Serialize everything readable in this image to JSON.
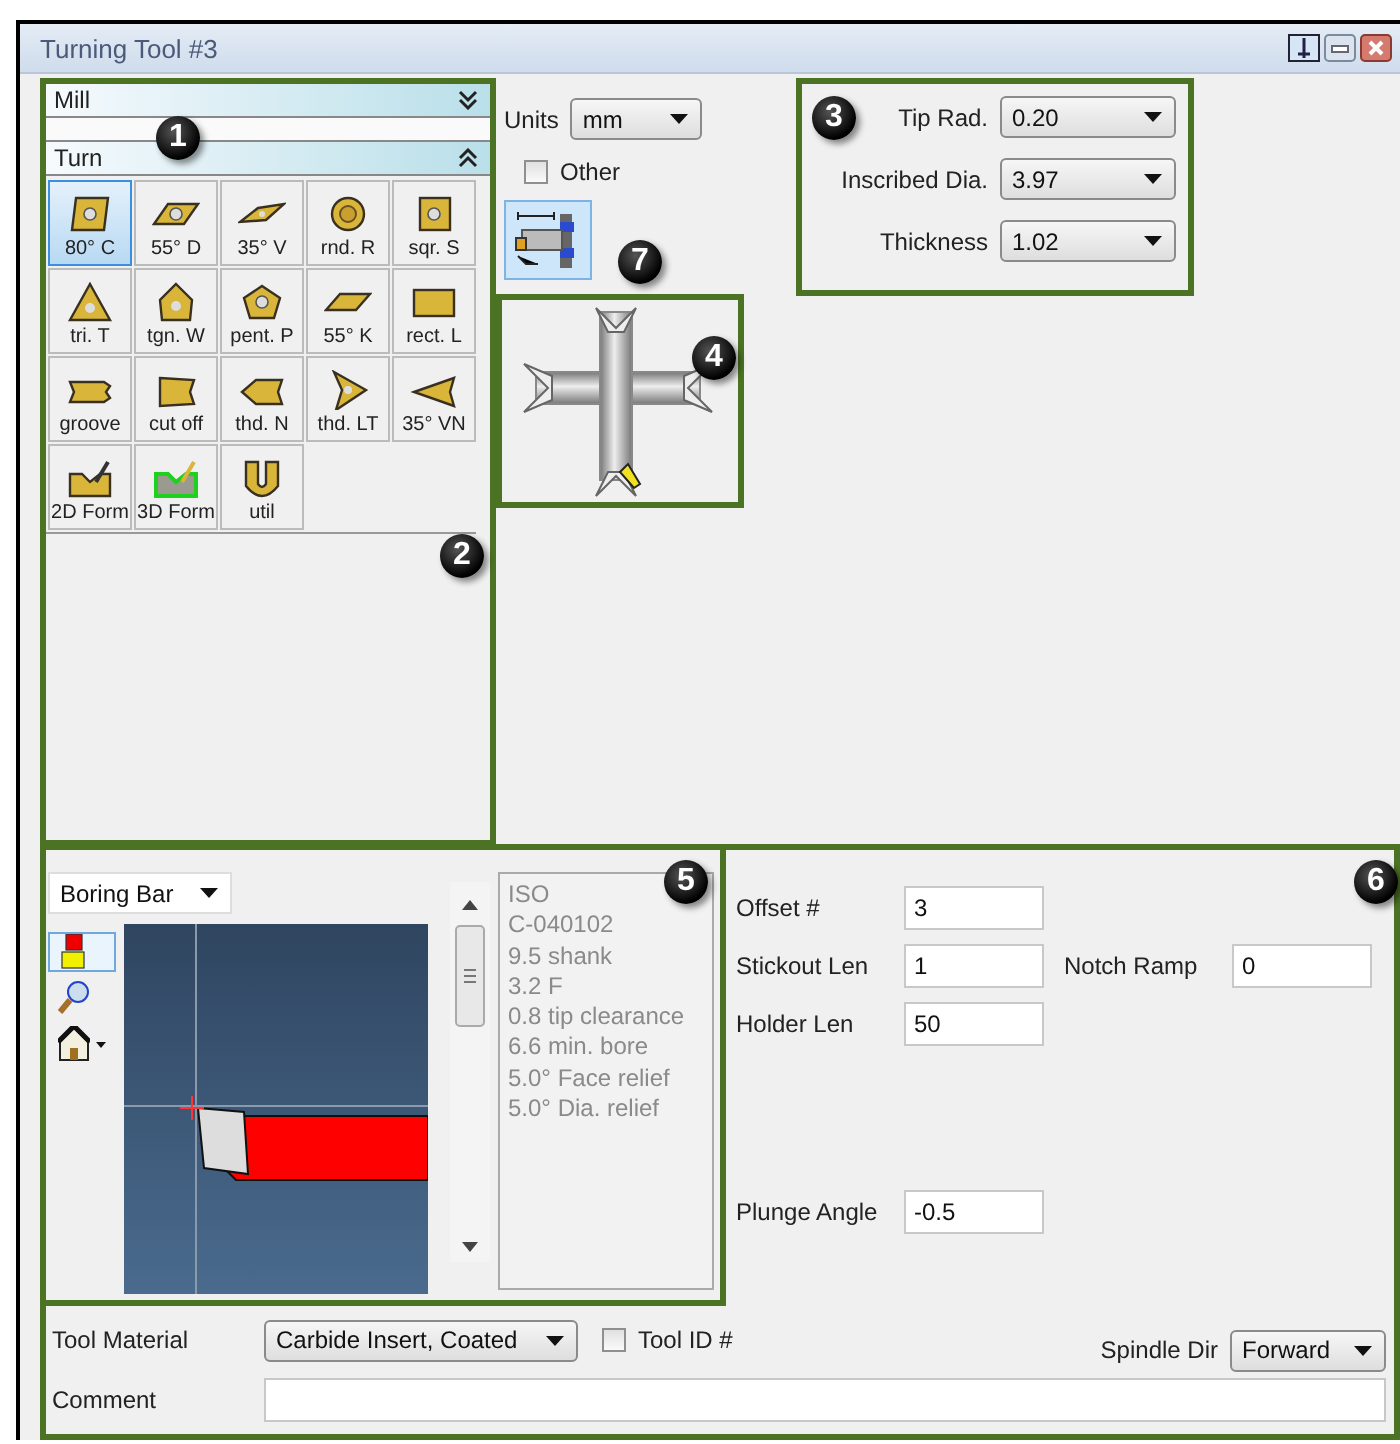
{
  "window": {
    "title": "Turning Tool #3"
  },
  "title_buttons": [
    {
      "kind": "pin"
    },
    {
      "kind": "minimize"
    },
    {
      "kind": "close"
    }
  ],
  "sections": [
    {
      "label": "Mill",
      "expanded": false
    },
    {
      "label": "Turn",
      "expanded": true
    }
  ],
  "tools": [
    {
      "label": "80° C",
      "selected": true
    },
    {
      "label": "55° D",
      "selected": false
    },
    {
      "label": "35° V",
      "selected": false
    },
    {
      "label": "rnd. R",
      "selected": false
    },
    {
      "label": "sqr. S",
      "selected": false
    },
    {
      "label": "tri. T",
      "selected": false
    },
    {
      "label": "tgn. W",
      "selected": false
    },
    {
      "label": "pent. P",
      "selected": false
    },
    {
      "label": "55° K",
      "selected": false
    },
    {
      "label": "rect. L",
      "selected": false
    },
    {
      "label": "groove",
      "selected": false
    },
    {
      "label": "cut off",
      "selected": false
    },
    {
      "label": "thd. N",
      "selected": false
    },
    {
      "label": "thd. LT",
      "selected": false
    },
    {
      "label": "35° VN",
      "selected": false
    },
    {
      "label": "2D Form",
      "selected": false
    },
    {
      "label": "3D Form",
      "selected": false
    },
    {
      "label": "util",
      "selected": false
    }
  ],
  "units": {
    "label": "Units",
    "value": "mm"
  },
  "other": {
    "label": "Other",
    "checked": false
  },
  "holder_button": {
    "pressed": true
  },
  "insert": [
    {
      "label": "Tip Rad.",
      "value": "0.20"
    },
    {
      "label": "Inscribed Dia.",
      "value": "3.97"
    },
    {
      "label": "Thickness",
      "value": "1.02"
    }
  ],
  "holder_type": {
    "value": "Boring Bar"
  },
  "view_tools": [
    {
      "selected": true
    },
    {
      "selected": false
    },
    {
      "selected": false
    }
  ],
  "info_lines": [
    "ISO",
    "C-040102",
    "9.5 shank",
    "3.2 F",
    "0.8 tip clearance",
    "6.6 min. bore",
    "5.0° Face relief",
    "5.0° Dia. relief"
  ],
  "fields": [
    {
      "label": "Offset #",
      "value": "3"
    },
    {
      "label": "Stickout Len",
      "value": "1"
    },
    {
      "label": "Notch Ramp",
      "value": "0"
    },
    {
      "label": "Holder Len",
      "value": "50"
    },
    {
      "label": "Plunge Angle",
      "value": "-0.5"
    }
  ],
  "tool_material": {
    "label": "Tool Material",
    "value": "Carbide Insert, Coated"
  },
  "tool_id": {
    "label": "Tool ID #",
    "checked": false
  },
  "spindle_dir": {
    "label": "Spindle Dir",
    "value": "Forward"
  },
  "comment": {
    "label": "Comment"
  },
  "callouts": [
    "1",
    "2",
    "3",
    "4",
    "5",
    "6",
    "7"
  ]
}
